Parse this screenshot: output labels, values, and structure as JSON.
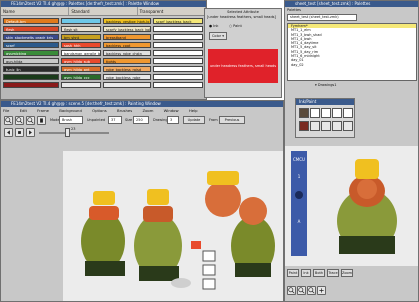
{
  "palette_window": {
    "title": "FE14m2test V2 TI.4 gh@@ : Palettes [de:thefr_test:zmk] : Palette Window",
    "headers": [
      "Name",
      "Standard",
      "Transparent"
    ],
    "rows": [
      {
        "name": "Default-bm",
        "a": "",
        "b": "backless_vestige_high-lo",
        "c": "scarf_backless_back",
        "ca": "#e07a1c",
        "cb": "#6ec8e8"
      },
      {
        "name": "flesh",
        "a": "flesh sit",
        "b": "scarfy_backless_back_kobi",
        "c": "",
        "ca": "#f0e6c8",
        "cb": "#e8e0d0"
      },
      {
        "name": "skin_stockmelts_gradr_kris",
        "a": "bm_shnt",
        "b": "breastband",
        "c": "",
        "ca": "#b54a2c",
        "cb": "#c8a020"
      },
      {
        "name": "scarf",
        "a": "sash_hhh",
        "b": "backless_coat",
        "c": "",
        "ca": "#2c5a8c",
        "cb": "#f09830"
      },
      {
        "name": "gyumicking",
        "a": "bandsman_gergile_bm_stm",
        "b": "backless_robe_chstn",
        "c": "",
        "ca": "#3a8c3a",
        "cb": "#ffffff"
      },
      {
        "name": "gun-hilda",
        "a": "gym_hilda_sub",
        "b": "tights",
        "c": "",
        "ca": "#c8c8c8",
        "cb": "#e84a2c"
      },
      {
        "name": "tunic_lin",
        "a": "gym_hilda_pnt",
        "b": "robe_backless_raisd",
        "c": "",
        "ca": "#2a2a2a",
        "cb": "#d86e2c"
      },
      {
        "name": "",
        "a": "gym_hilda_ccc",
        "b": "robe_backless_robe",
        "c": "",
        "ca": "#1a3a1a",
        "cb": "#f0a860"
      },
      {
        "name": "",
        "a": "",
        "b": "",
        "c": "",
        "ca": "#8a1a1a",
        "cb": "#e8e8e8"
      }
    ]
  },
  "selected_attribute": {
    "title": "Selected Attribute",
    "line": "[under headress feathers, small heads]",
    "ink_label": "Ink",
    "paint_label": "Paint",
    "color_label": "Color",
    "swatch_text": "under headress feathers, small heads",
    "swatch_color": "#e0222a"
  },
  "right_panel": {
    "title": "sheet_test [sheet_test.zmk] : Palettes",
    "palettes_label": "Palettes",
    "palette_field": "sheet_test (sheet_test.zmk)",
    "items": [
      "Fymhem*",
      "MT1_1_elm",
      "MT1_3_bwh_shad",
      "MT1_4_bwh",
      "MT1_4_daytime",
      "MT1_5_day_sit",
      "MT1_5_day_rim",
      "MT1_6_midnight",
      "day_01",
      "day_02"
    ],
    "drawings_label": "Drawings1",
    "ink_paint_title": "Ink/Paint",
    "bottom_tabs": [
      "Paint",
      "Ink",
      "Both",
      "Trace",
      "Zoom"
    ],
    "footer_buttons": [
      "zoom-in",
      "zoom-out",
      "zoom-fit",
      "flip"
    ]
  },
  "painting_window": {
    "title": "FE14m2test V2 TI.4 gh@@ : scene.5 [de:thefr_test:zmk] : Painting Window",
    "menu": [
      "File",
      "Edit",
      "Frame",
      "Background",
      "Options",
      "Brushes",
      "Help"
    ],
    "menu_extra": [
      "Zoom",
      "Window"
    ],
    "mode_label": "Mode",
    "mode_value": "Brush",
    "unpainted_label": "Unpainted",
    "unpainted_value": "37",
    "size_label": "Size",
    "size_value": "250",
    "drawing_label": "Drawing",
    "drawing_value": "3",
    "update_label": "Update",
    "from_label": "From",
    "previous_label": "Previous",
    "slider_value": "23"
  },
  "overlay_panel": {
    "label_top": "CMCU",
    "label_mid": "1",
    "label_bottom": "A"
  },
  "colors": {
    "accent": "#3a5a8c",
    "panel": "#c8c8c8",
    "canvas": "#ececec",
    "highlight": "#f5e878"
  }
}
